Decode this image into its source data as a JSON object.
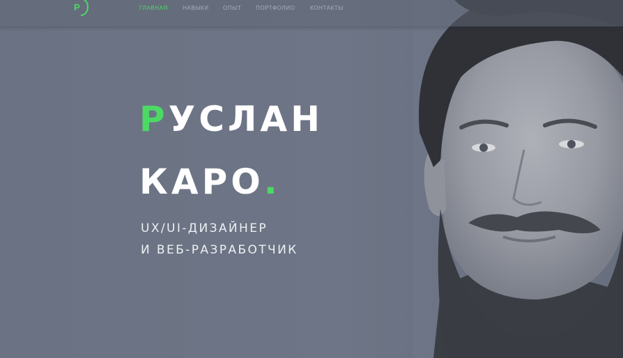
{
  "header": {
    "logo_letter": "Р",
    "nav": [
      {
        "label": "Главная",
        "active": true
      },
      {
        "label": "Навыки",
        "active": false
      },
      {
        "label": "Опыт",
        "active": false
      },
      {
        "label": "Портфолио",
        "active": false
      },
      {
        "label": "Контакты",
        "active": false
      }
    ]
  },
  "hero": {
    "first_name_initial": "Р",
    "first_name_rest": "УСЛАН",
    "last_name": "КАРО",
    "last_name_dot": ".",
    "subtitle_line1": "UX/UI-ДИЗАЙНЕР",
    "subtitle_line2": "И ВЕБ-РАЗРАБОТЧИК"
  },
  "colors": {
    "accent": "#4cd964",
    "background": "#6d7585",
    "text": "#ffffff",
    "nav_text": "#a9afba"
  }
}
